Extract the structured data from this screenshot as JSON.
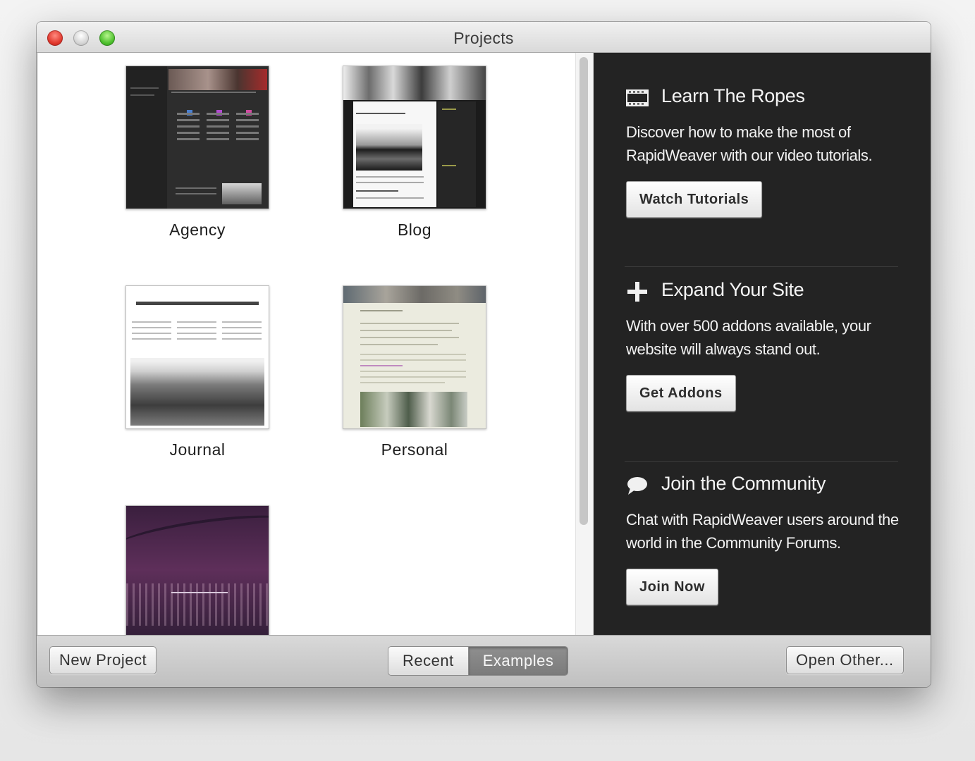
{
  "window": {
    "title": "Projects"
  },
  "gallery": {
    "items": [
      {
        "label": "Agency"
      },
      {
        "label": "Blog"
      },
      {
        "label": "Journal"
      },
      {
        "label": "Personal"
      },
      {
        "label": ""
      }
    ]
  },
  "panel": {
    "sections": [
      {
        "icon": "film-strip-icon",
        "title": "Learn The Ropes",
        "text": "Discover how to make the most of RapidWeaver with our video tutorials.",
        "button": "Watch Tutorials"
      },
      {
        "icon": "plus-icon",
        "title": "Expand Your Site",
        "text": "With over 500 addons available, your website will always stand out.",
        "button": "Get Addons"
      },
      {
        "icon": "speech-bubble-icon",
        "title": "Join the Community",
        "text": "Chat with RapidWeaver users around the world in the Community Forums.",
        "button": "Join Now"
      }
    ]
  },
  "footer": {
    "new_project": "New Project",
    "segments": {
      "recent": "Recent",
      "examples": "Examples",
      "selected": "Examples"
    },
    "open_other": "Open Other..."
  },
  "colors": {
    "panel_bg": "#232323",
    "segment_selected": "#7f7f7f",
    "close": "#e0372c",
    "minimize": "#c9c9c9",
    "zoom": "#4cbf2c"
  }
}
